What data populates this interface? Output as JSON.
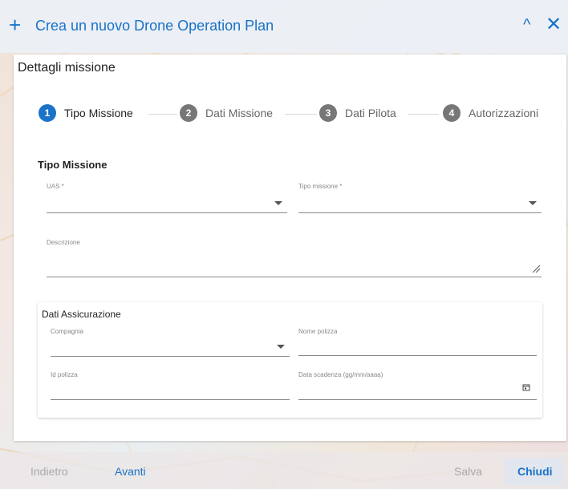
{
  "header": {
    "title": "Crea un nuovo Drone Operation Plan",
    "add_icon": "plus-icon",
    "collapse_icon": "chevron-up-icon",
    "close_icon": "close-icon",
    "accent_color": "#1a73c8"
  },
  "card": {
    "title": "Dettagli missione",
    "steps": [
      {
        "num": "1",
        "label": "Tipo Missione",
        "active": true
      },
      {
        "num": "2",
        "label": "Dati Missione",
        "active": false
      },
      {
        "num": "3",
        "label": "Dati Pilota",
        "active": false
      },
      {
        "num": "4",
        "label": "Autorizzazioni",
        "active": false
      }
    ],
    "section_title": "Tipo Missione",
    "fields": {
      "uas": {
        "label": "UAS *",
        "value": ""
      },
      "tipo_missione": {
        "label": "Tipo missione *",
        "value": ""
      },
      "descrizione": {
        "label": "Descrizione",
        "value": ""
      }
    },
    "insurance": {
      "title": "Dati Assicurazione",
      "compagnia": {
        "label": "Compagnia",
        "value": ""
      },
      "nome_polizza": {
        "label": "Nome polizza",
        "value": ""
      },
      "id_polizza": {
        "label": "Id polizza",
        "value": ""
      },
      "data_scadenza": {
        "label": "Data scadenza (gg/mm/aaaa)",
        "value": "",
        "icon": "calendar-icon"
      }
    }
  },
  "footer": {
    "indietro": "Indietro",
    "avanti": "Avanti",
    "salva": "Salva",
    "chiudi": "Chiudi"
  }
}
